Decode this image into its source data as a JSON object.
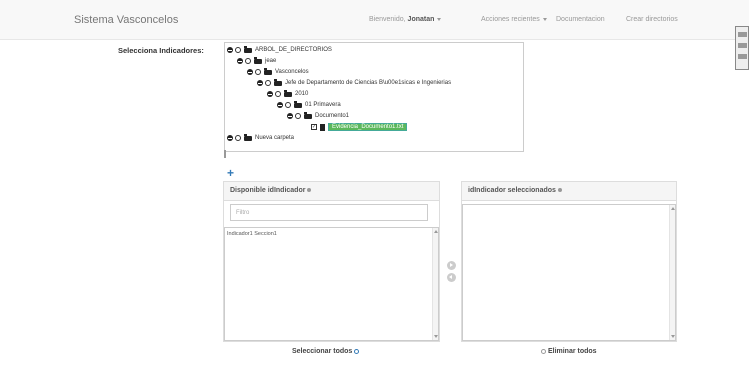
{
  "navbar": {
    "brand": "Sistema Vasconcelos",
    "welcome_prefix": "Bienvenido,",
    "user": "Jonatan",
    "recent_actions": "Acciones recientes",
    "documentation": "Documentacion",
    "create_dirs": "Crear directorios"
  },
  "form": {
    "indicators_label": "Selecciona Indicadores:"
  },
  "tree": {
    "nodes": [
      {
        "label": "ARBOL_DE_DIRECTORIOS"
      },
      {
        "label": "jeae"
      },
      {
        "label": "Vasconcelos"
      },
      {
        "label": "Jefe de Departamento de Ciencias B\\u00e1sicas e Ingenierias"
      },
      {
        "label": "2010"
      },
      {
        "label": "01 Primavera"
      },
      {
        "label": "Documento1"
      },
      {
        "label": "Evidencia_Documento1.txt",
        "selected": true
      },
      {
        "label": "Nueva carpeta"
      }
    ]
  },
  "available": {
    "title": "Disponible idIndicador",
    "filter_placeholder": "Filtro",
    "options": [
      "Indicador1 Seccion1"
    ],
    "select_all": "Seleccionar todos"
  },
  "selected": {
    "title": "idIndicador seleccionados",
    "remove_all": "Eliminar todos"
  },
  "colors": {
    "accent": "#337ab7",
    "highlight": "#5cb85c"
  }
}
